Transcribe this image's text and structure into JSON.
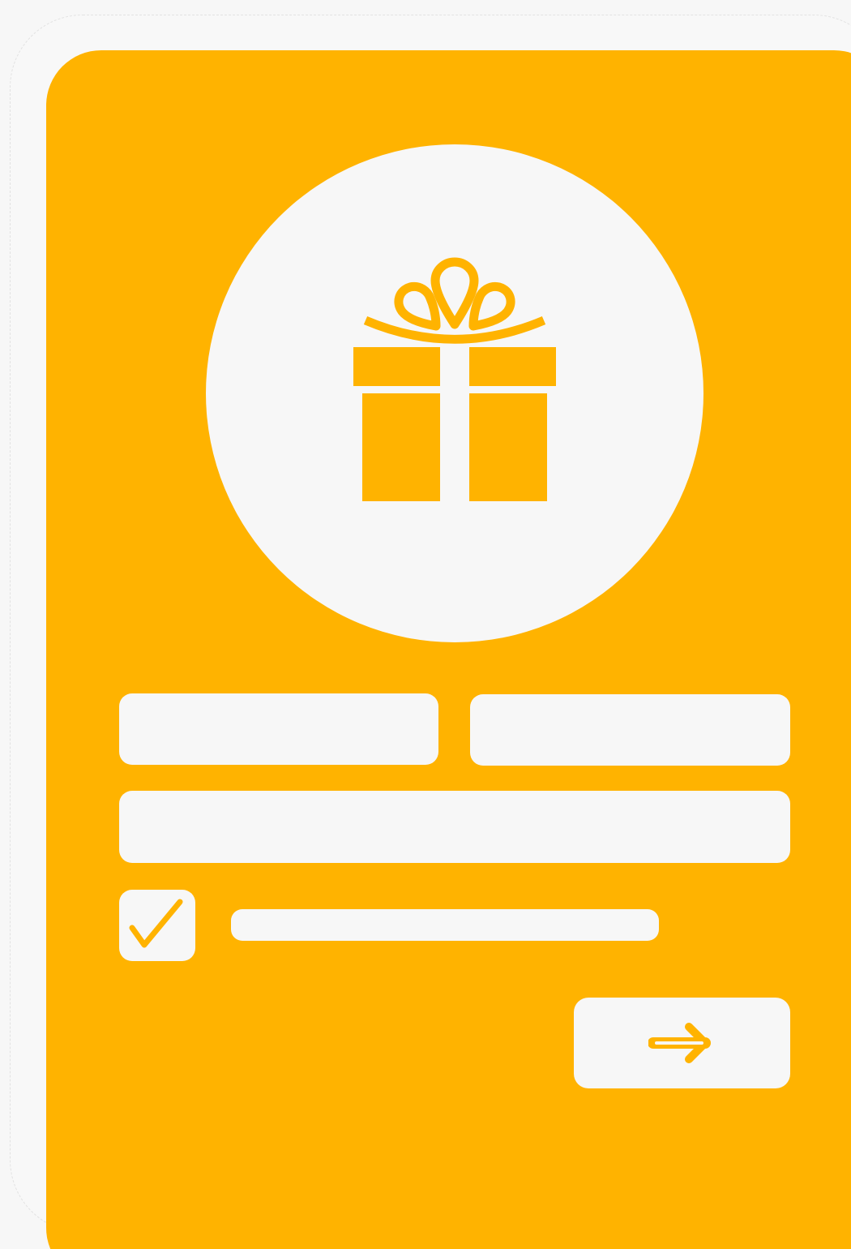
{
  "theme": {
    "accent": "#FFB300",
    "surface": "#F7F7F7"
  },
  "hero": {
    "icon": "gift-icon"
  },
  "form": {
    "first_field": {
      "value": "",
      "placeholder": ""
    },
    "second_field": {
      "value": "",
      "placeholder": ""
    },
    "wide_field": {
      "value": "",
      "placeholder": ""
    },
    "consent": {
      "checked": true,
      "icon": "check-icon",
      "label": ""
    },
    "submit": {
      "icon": "arrow-right-icon",
      "label": ""
    }
  }
}
